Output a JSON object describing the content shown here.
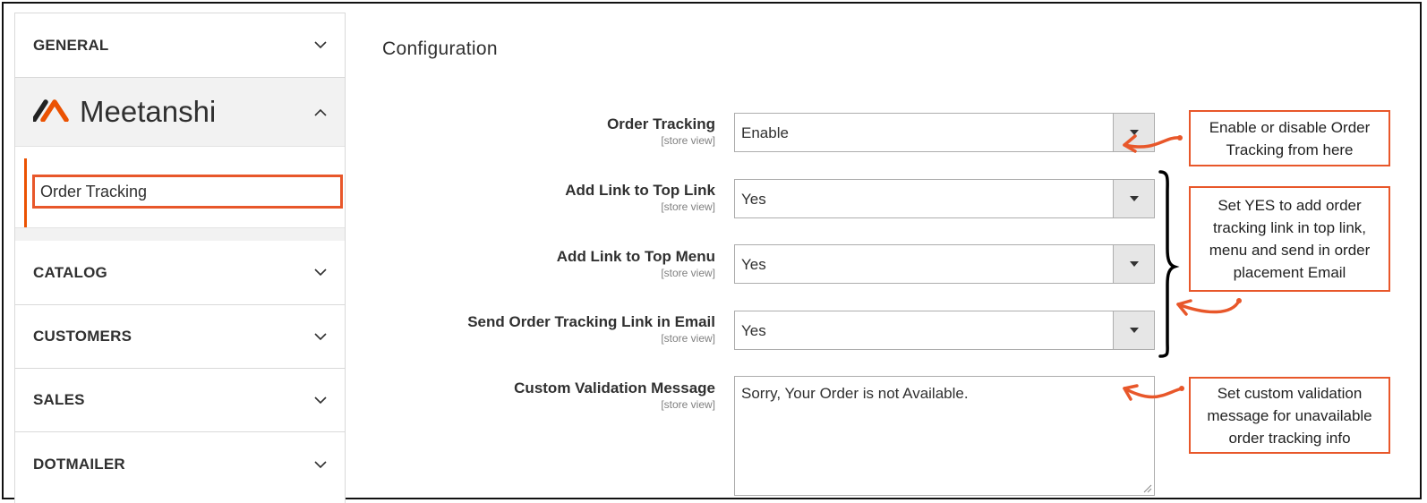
{
  "sidebar": {
    "sections": [
      {
        "label": "GENERAL"
      },
      {
        "label": "CATALOG"
      },
      {
        "label": "CUSTOMERS"
      },
      {
        "label": "SALES"
      },
      {
        "label": "DOTMAILER"
      }
    ],
    "brand": {
      "name": "Meetanshi",
      "logo_icon": "meetanshi-logo-icon"
    },
    "active_item": "Order Tracking"
  },
  "main": {
    "title": "Configuration",
    "fields": [
      {
        "label": "Order Tracking",
        "scope": "[store view]",
        "value": "Enable"
      },
      {
        "label": "Add Link to Top Link",
        "scope": "[store view]",
        "value": "Yes"
      },
      {
        "label": "Add Link to Top Menu",
        "scope": "[store view]",
        "value": "Yes"
      },
      {
        "label": "Send Order Tracking Link in Email",
        "scope": "[store view]",
        "value": "Yes"
      },
      {
        "label": "Custom Validation Message",
        "scope": "[store view]",
        "value": "Sorry, Your Order is not Available."
      }
    ]
  },
  "callouts": [
    {
      "text": "Enable or disable Order Tracking from here"
    },
    {
      "text": "Set YES to add order tracking link in top link, menu and send in order placement Email"
    },
    {
      "text": "Set custom validation message for unavailable order tracking info"
    }
  ],
  "colors": {
    "accent": "#e8572a",
    "brand_accent": "#eb5202",
    "text": "#303030"
  }
}
